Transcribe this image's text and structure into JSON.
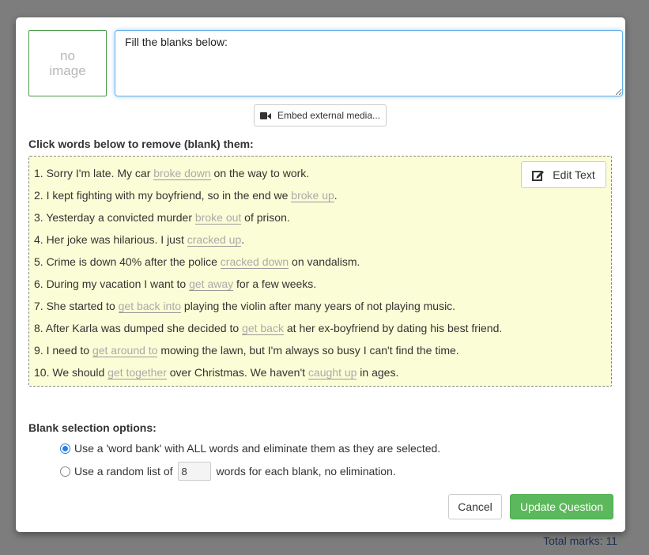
{
  "footer": {
    "total_marks": "Total marks: 11"
  },
  "image_placeholder": {
    "line1": "no",
    "line2": "image"
  },
  "question": {
    "text": "Fill the blanks below:"
  },
  "embed": {
    "label": "Embed external media...",
    "icon": "video-camera-icon"
  },
  "instructions": "Click words below to remove (blank) them:",
  "edit_text_label": "Edit Text",
  "edit_text_icon": "edit-icon",
  "sentences": [
    [
      {
        "t": "1. Sorry I'm late. My car "
      },
      {
        "w": "broke down"
      },
      {
        "t": " on the way to work."
      }
    ],
    [
      {
        "t": "2. I kept fighting with my boyfriend, so in the end we "
      },
      {
        "w": "broke up"
      },
      {
        "t": "."
      }
    ],
    [
      {
        "t": "3. Yesterday a convicted murder "
      },
      {
        "w": "broke out"
      },
      {
        "t": " of prison."
      }
    ],
    [
      {
        "t": "4. Her joke was hilarious. I just "
      },
      {
        "w": "cracked up"
      },
      {
        "t": "."
      }
    ],
    [
      {
        "t": "5. Crime is down 40% after the police "
      },
      {
        "w": "cracked down"
      },
      {
        "t": " on vandalism."
      }
    ],
    [
      {
        "t": "6. During my vacation I want to "
      },
      {
        "w": "get away"
      },
      {
        "t": " for a few weeks."
      }
    ],
    [
      {
        "t": "7. She started to "
      },
      {
        "w": "get back into"
      },
      {
        "t": " playing the violin after many years of not playing music."
      }
    ],
    [
      {
        "t": "8. After Karla was dumped she decided to "
      },
      {
        "w": "get back"
      },
      {
        "t": " at her ex-boyfriend by dating his best friend."
      }
    ],
    [
      {
        "t": "9. I need to "
      },
      {
        "w": "get around to"
      },
      {
        "t": " mowing the lawn, but I'm always so busy I can't find the time."
      }
    ],
    [
      {
        "t": "10. We should "
      },
      {
        "w": "get together"
      },
      {
        "t": " over Christmas. We haven't "
      },
      {
        "w": "caught up"
      },
      {
        "t": " in ages."
      }
    ]
  ],
  "blank_options": {
    "heading": "Blank selection options:",
    "option1": "Use a 'word bank' with ALL words and eliminate them as they are selected.",
    "option1_selected": true,
    "option2_before": "Use a random list of",
    "option2_value": "8",
    "option2_after": "words for each blank, no elimination.",
    "option2_selected": false
  },
  "buttons": {
    "cancel": "Cancel",
    "update": "Update Question"
  },
  "colors": {
    "primary_green": "#5cb85c",
    "editor_bg": "#fbfdd6",
    "radio_blue": "#2a7de1"
  }
}
